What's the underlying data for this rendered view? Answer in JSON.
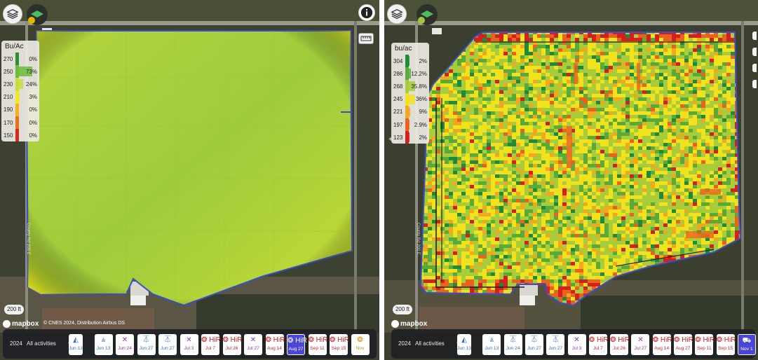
{
  "left": {
    "legend": {
      "title": "Bu/Ac",
      "rows": [
        {
          "value": "270",
          "color": "#2a8f3a",
          "pct": "0%",
          "share": 0
        },
        {
          "value": "250",
          "color": "#6dbb3c",
          "pct": "73%",
          "share": 73
        },
        {
          "value": "230",
          "color": "#c8dc3a",
          "pct": "24%",
          "share": 24
        },
        {
          "value": "210",
          "color": "#f0e62a",
          "pct": "3%",
          "share": 3
        },
        {
          "value": "190",
          "color": "#f2b21e",
          "pct": "0%",
          "share": 0
        },
        {
          "value": "170",
          "color": "#e8701e",
          "pct": "0%",
          "share": 0
        },
        {
          "value": "150",
          "color": "#d42a1e",
          "pct": "0%",
          "share": 0
        }
      ]
    },
    "scale": "200 ft",
    "logo": "mapbox",
    "attribution": "© CNES 2024, Distribution Airbus DS",
    "road_label": "County Rd 200 E"
  },
  "right": {
    "legend": {
      "title": "bu/ac",
      "rows": [
        {
          "value": "304",
          "color": "#1e8a3a",
          "pct": "2%",
          "share": 2
        },
        {
          "value": "286",
          "color": "#5aaa3a",
          "pct": "12.2%",
          "share": 12.2
        },
        {
          "value": "268",
          "color": "#a8cc3a",
          "pct": "35.8%",
          "share": 35.8
        },
        {
          "value": "245",
          "color": "#f2e21e",
          "pct": "36%",
          "share": 36
        },
        {
          "value": "221",
          "color": "#f2a81e",
          "pct": "9%",
          "share": 9
        },
        {
          "value": "197",
          "color": "#e8641e",
          "pct": "2.9%",
          "share": 2.9
        },
        {
          "value": "123",
          "color": "#d4201e",
          "pct": "2%",
          "share": 2
        }
      ]
    },
    "scale": "200 ft",
    "logo": "mapbox",
    "road_label": "County Rd 200 E"
  },
  "timeline": {
    "year": "2024",
    "filter": "All activities",
    "prev_glyph": "‹",
    "left_chips": [
      {
        "icon": "◭",
        "date": "Jun 13",
        "kind": "blue",
        "partial": true
      },
      {
        "icon": "⩓",
        "date": "Jun 13",
        "kind": "blue"
      },
      {
        "icon": "✕",
        "date": "Jun 24",
        "kind": "purple"
      },
      {
        "icon": "⏄",
        "date": "Jun 27",
        "kind": "blue"
      },
      {
        "icon": "⏄",
        "date": "Jun 27",
        "kind": "blue"
      },
      {
        "icon": "✕",
        "date": "Jul 3",
        "kind": "purple"
      },
      {
        "icon": "❂ HiR",
        "date": "Jul 7",
        "kind": "red"
      },
      {
        "icon": "❂ HiR",
        "date": "Jul 26",
        "kind": "red"
      },
      {
        "icon": "✕",
        "date": "Jul 27",
        "kind": "purple"
      },
      {
        "icon": "❂ HiR",
        "date": "Aug 14",
        "kind": "red"
      },
      {
        "icon": "❂ HiR",
        "date": "Aug 27",
        "kind": "blue",
        "selected": true
      },
      {
        "icon": "❂ HiR",
        "date": "Sep 11",
        "kind": "red"
      },
      {
        "icon": "❂ HiR",
        "date": "Sep 15",
        "kind": "red"
      },
      {
        "icon": "❂",
        "date": "Nov",
        "kind": "orange"
      }
    ],
    "right_chips": [
      {
        "icon": "◭",
        "date": "Jun 13",
        "kind": "blue",
        "partial": true
      },
      {
        "icon": "⩓",
        "date": "Jun 13",
        "kind": "blue"
      },
      {
        "icon": "⏄",
        "date": "Jun 24",
        "kind": "blue"
      },
      {
        "icon": "⏄",
        "date": "Jun 27",
        "kind": "blue"
      },
      {
        "icon": "⏄",
        "date": "Jun 27",
        "kind": "blue"
      },
      {
        "icon": "✕",
        "date": "Jul 3",
        "kind": "purple"
      },
      {
        "icon": "❂ HiR",
        "date": "Jul 7",
        "kind": "red"
      },
      {
        "icon": "❂ HiR",
        "date": "Jul 26",
        "kind": "red"
      },
      {
        "icon": "✕",
        "date": "Jul 27",
        "kind": "purple"
      },
      {
        "icon": "❂ HiR",
        "date": "Aug 14",
        "kind": "red"
      },
      {
        "icon": "❂ HiR",
        "date": "Aug 27",
        "kind": "red"
      },
      {
        "icon": "❂ HiR",
        "date": "Sep 11",
        "kind": "red"
      },
      {
        "icon": "❂ HiR",
        "date": "Sep 15",
        "kind": "red"
      },
      {
        "icon": "⛟",
        "date": "Nov 1",
        "kind": "blue",
        "selected": true
      }
    ]
  },
  "colors": {
    "field_left_base": "#a9cf3a",
    "field_left_edge": "#f0ec1a",
    "field_outline": "#3a4fc8",
    "selected_chip": "#4a46d6",
    "timeline_bg": "#202024"
  },
  "icons": [
    "layers-icon",
    "field-thumbnail-icon",
    "info-icon",
    "ruler-icon",
    "plus-icon",
    "mapbox-logo"
  ]
}
